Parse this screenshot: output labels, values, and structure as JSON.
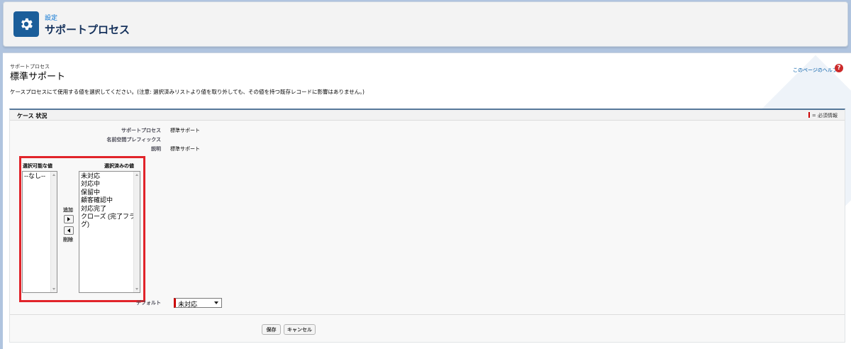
{
  "header": {
    "breadcrumb": "設定",
    "title": "サポートプロセス",
    "icon": "gear-icon"
  },
  "page": {
    "subtitle": "サポートプロセス",
    "title": "標準サポート",
    "help_link": "このページのヘルプ",
    "help_icon": "help-icon",
    "instructions": "ケースプロセスにて使用する値を選択してください。(注意: 選択済みリストより値を取り外しても、その値を持つ既存レコードに影響はありません。)"
  },
  "section": {
    "title": "ケース 状況",
    "required_info": "= 必須情報",
    "fields": [
      {
        "label": "サポートプロセス",
        "value": "標準サポート"
      },
      {
        "label": "名前空間プレフィックス",
        "value": ""
      },
      {
        "label": "説明",
        "value": "標準サポート"
      }
    ],
    "available_label": "選択可能な値",
    "available_values": [
      "--なし--"
    ],
    "selected_label": "選択済みの値",
    "selected_values": [
      "未対応",
      "対応中",
      "保留中",
      "顧客確認中",
      "対応完了",
      "クローズ (完了フラグ)"
    ],
    "add_label": "追加",
    "remove_label": "削除",
    "default_label": "デフォルト",
    "default_value": "未対応"
  },
  "buttons": {
    "save": "保存",
    "cancel": "キャンセル"
  },
  "colors": {
    "header_icon_bg": "#1b5e9a",
    "highlight_border": "#e1242a",
    "required_mark": "#cc0000",
    "link": "#015ba7"
  }
}
